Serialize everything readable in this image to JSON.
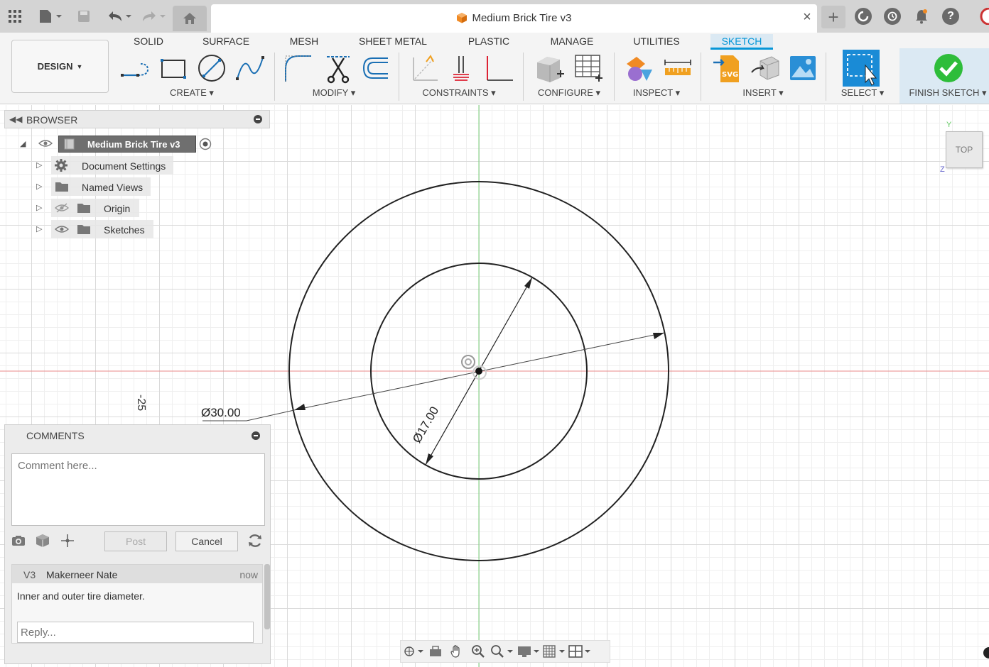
{
  "window": {
    "document_title": "Medium Brick Tire v3"
  },
  "toolbar": {
    "workspace_label": "DESIGN",
    "tabs": [
      {
        "label": "SOLID"
      },
      {
        "label": "SURFACE"
      },
      {
        "label": "MESH"
      },
      {
        "label": "SHEET METAL"
      },
      {
        "label": "PLASTIC"
      },
      {
        "label": "MANAGE"
      },
      {
        "label": "UTILITIES"
      },
      {
        "label": "SKETCH",
        "active": true
      }
    ],
    "groups": {
      "create": "CREATE",
      "modify": "MODIFY",
      "constraints": "CONSTRAINTS",
      "configure": "CONFIGURE",
      "inspect": "INSPECT",
      "insert": "INSERT",
      "select": "SELECT",
      "finish": "FINISH SKETCH"
    },
    "colors": {
      "accent": "#0696d7",
      "finish_green": "#2ebd3a"
    }
  },
  "browser": {
    "title": "BROWSER",
    "root": "Medium Brick Tire v3",
    "items": [
      {
        "label": "Document Settings",
        "icon": "gear-icon"
      },
      {
        "label": "Named Views",
        "icon": "folder-icon"
      },
      {
        "label": "Origin",
        "icon": "folder-icon",
        "hidden": true
      },
      {
        "label": "Sketches",
        "icon": "folder-icon"
      }
    ]
  },
  "sketch": {
    "outer_dimension": "Ø30.00",
    "inner_dimension": "Ø17.00",
    "ruler_value": "-25"
  },
  "viewcube": {
    "face": "TOP",
    "axis_y": "Y",
    "axis_z": "Z"
  },
  "comments": {
    "title": "COMMENTS",
    "input_placeholder": "Comment here...",
    "post_label": "Post",
    "cancel_label": "Cancel",
    "thread": {
      "version": "V3",
      "author": "Makerneer Nate",
      "time": "now",
      "text": "Inner and outer tire diameter.",
      "reply_placeholder": "Reply..."
    }
  }
}
